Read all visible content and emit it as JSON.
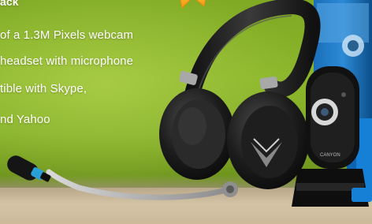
{
  "text": {
    "heading": "ack",
    "line1": "of a 1.3M Pixels webcam",
    "line2": "headset with microphone",
    "line3": "tible with Skype,",
    "line4": "nd Yahoo"
  },
  "colors": {
    "background_green": "#82ad26",
    "text": "#ffffff",
    "accent_blue": "#2a9fd8",
    "badge_orange": "#f39a12"
  },
  "icons": [
    "starburst-badge-icon",
    "microphone-icon"
  ]
}
